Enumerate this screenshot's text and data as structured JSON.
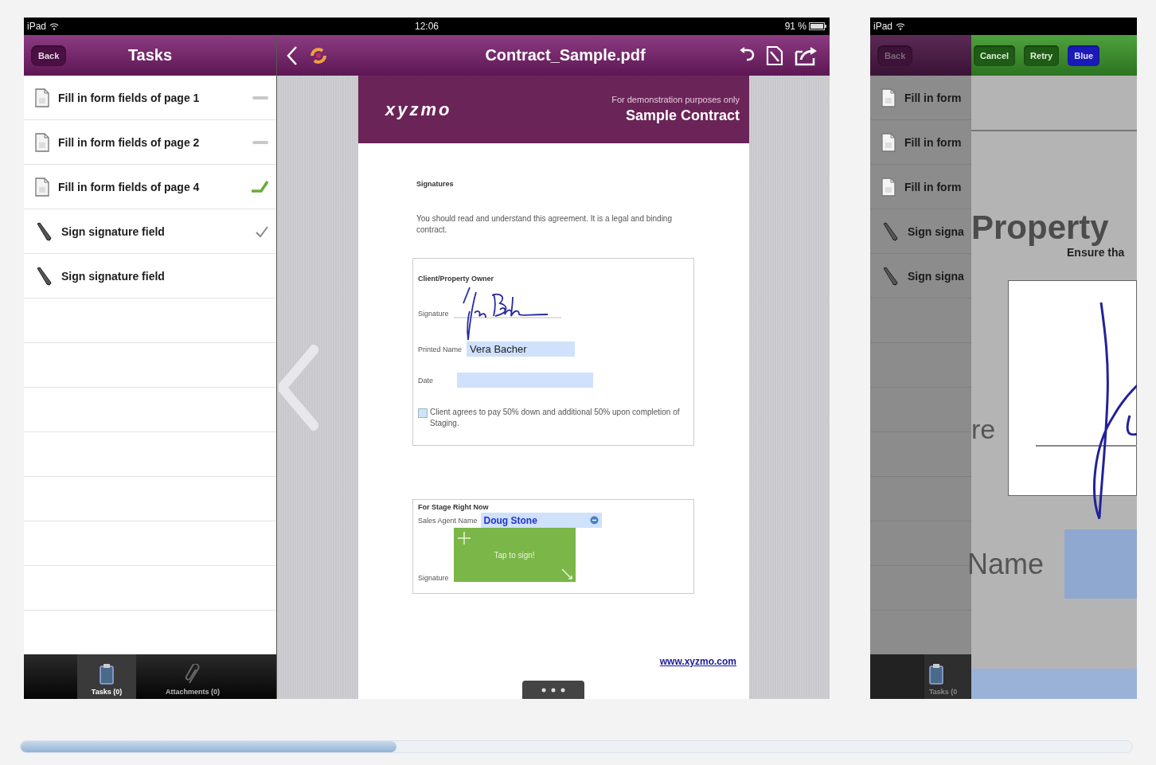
{
  "main_screen": {
    "status_bar": {
      "carrier": "iPad",
      "time": "12:06",
      "battery": "91 %"
    },
    "tasks_pane": {
      "back": "Back",
      "title": "Tasks",
      "items": [
        {
          "kind": "form",
          "label": "Fill in form fields of page 1",
          "completed": false
        },
        {
          "kind": "form",
          "label": "Fill in form fields of page 2",
          "completed": false
        },
        {
          "kind": "form",
          "label": "Fill in form fields of page 4",
          "completed": true
        },
        {
          "kind": "signature",
          "label": "Sign signature field",
          "completed": true
        },
        {
          "kind": "signature",
          "label": "Sign signature field",
          "completed": false
        }
      ],
      "tabs": [
        {
          "kind": "tasks",
          "label": "Tasks (0)",
          "selected": true
        },
        {
          "kind": "attachments",
          "label": "Attachments (0)",
          "selected": false
        }
      ]
    },
    "viewer": {
      "title": "Contract_Sample.pdf",
      "document": {
        "logo": "xyzmo",
        "note": "For demonstration purposes only",
        "title": "Sample Contract",
        "heading": "Signatures",
        "intro": "You should read and understand this agreement. It is a legal and binding contract.",
        "owner_box": {
          "title": "Client/Property Owner",
          "signature_label": "Signature",
          "name_label": "Printed Name",
          "name_value": "Vera Bacher",
          "date_label": "Date",
          "agreement": {
            "checked": false,
            "text": "Client agrees to pay 50% down and additional 50% upon completion of Staging."
          }
        },
        "agent_box": {
          "title": "For Stage Right Now",
          "name_label": "Sales Agent Name",
          "name_value": "Doug Stone",
          "signature_label": "Signature",
          "sign_prompt": "Tap to sign!"
        },
        "link": "www.xyzmo.com"
      }
    }
  },
  "second_screen": {
    "status_bar": {
      "carrier": "iPad"
    },
    "tasks_pane": {
      "back": "Back",
      "items": [
        {
          "kind": "form",
          "label": "Fill in form"
        },
        {
          "kind": "form",
          "label": "Fill in form"
        },
        {
          "kind": "form",
          "label": "Fill in form"
        },
        {
          "kind": "signature",
          "label": "Sign signa"
        },
        {
          "kind": "signature",
          "label": "Sign signa"
        }
      ],
      "tabs": [
        {
          "kind": "tasks",
          "label": "Tasks (0",
          "selected": true
        }
      ]
    },
    "sign_dialog": {
      "buttons": [
        {
          "kind": "plain",
          "label": "Cancel"
        },
        {
          "kind": "plain",
          "label": "Retry"
        },
        {
          "kind": "color",
          "label": "Blue"
        }
      ],
      "title": "Property",
      "subtitle": "Ensure tha",
      "signature_label": "re",
      "name_label": "Name"
    }
  }
}
